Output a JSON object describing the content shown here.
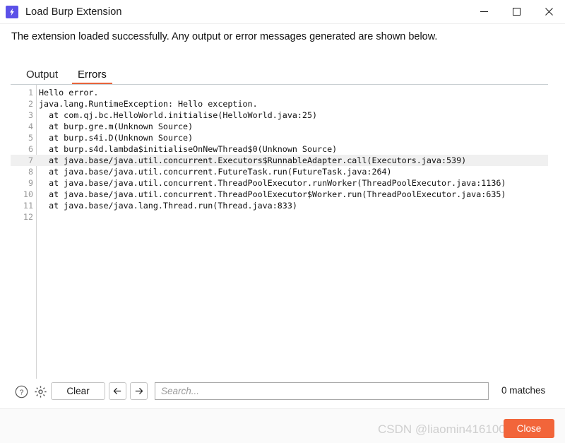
{
  "window": {
    "title": "Load Burp Extension",
    "app_icon": "lightning-bolt-icon",
    "controls": {
      "minimize": "minimize-icon",
      "maximize": "maximize-icon",
      "close": "close-icon"
    }
  },
  "subtitle": "The extension loaded successfully. Any output or error messages generated are shown below.",
  "tabs": [
    {
      "label": "Output",
      "active": false
    },
    {
      "label": "Errors",
      "active": true
    }
  ],
  "accent_color": "#e8633a",
  "close_button_color": "#f2653a",
  "console": {
    "lines": [
      {
        "no": "1",
        "text": "Hello error.",
        "highlight": false
      },
      {
        "no": "2",
        "text": "java.lang.RuntimeException: Hello exception.",
        "highlight": false
      },
      {
        "no": "3",
        "text": "  at com.qj.bc.HelloWorld.initialise(HelloWorld.java:25)",
        "highlight": false
      },
      {
        "no": "4",
        "text": "  at burp.gre.m(Unknown Source)",
        "highlight": false
      },
      {
        "no": "5",
        "text": "  at burp.s4i.D(Unknown Source)",
        "highlight": false
      },
      {
        "no": "6",
        "text": "  at burp.s4d.lambda$initialiseOnNewThread$0(Unknown Source)",
        "highlight": false
      },
      {
        "no": "7",
        "text": "  at java.base/java.util.concurrent.Executors$RunnableAdapter.call(Executors.java:539)",
        "highlight": true
      },
      {
        "no": "8",
        "text": "  at java.base/java.util.concurrent.FutureTask.run(FutureTask.java:264)",
        "highlight": false
      },
      {
        "no": "9",
        "text": "  at java.base/java.util.concurrent.ThreadPoolExecutor.runWorker(ThreadPoolExecutor.java:1136)",
        "highlight": false
      },
      {
        "no": "10",
        "text": "  at java.base/java.util.concurrent.ThreadPoolExecutor$Worker.run(ThreadPoolExecutor.java:635)",
        "highlight": false
      },
      {
        "no": "11",
        "text": "  at java.base/java.lang.Thread.run(Thread.java:833)",
        "highlight": false
      },
      {
        "no": "12",
        "text": "",
        "highlight": false
      }
    ]
  },
  "toolbar": {
    "help_icon": "question-mark-icon",
    "settings_icon": "gear-icon",
    "clear_label": "Clear",
    "prev_icon": "arrow-left-icon",
    "next_icon": "arrow-right-icon",
    "search_value": "",
    "search_placeholder": "Search...",
    "matches_label": "0 matches"
  },
  "footer": {
    "close_label": "Close",
    "watermark": "CSDN @liaomin416100569"
  }
}
